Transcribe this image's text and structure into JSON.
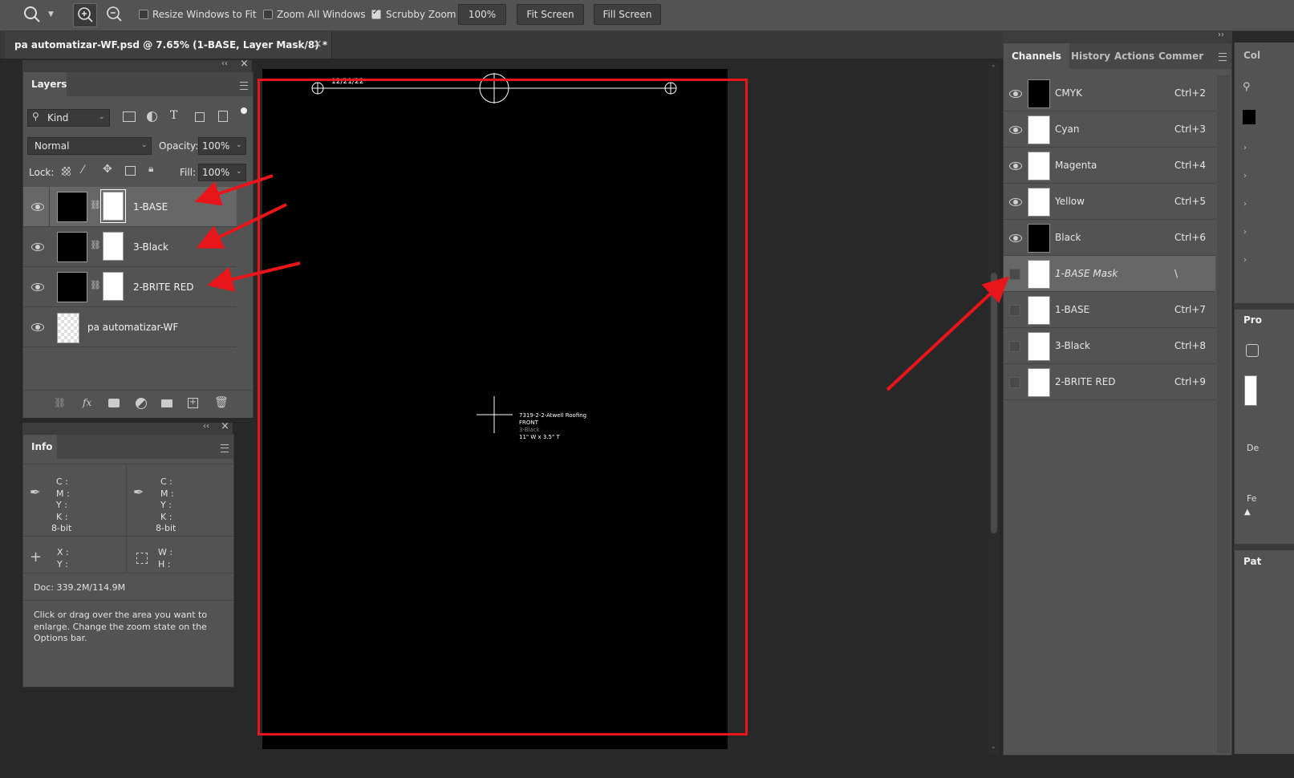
{
  "options_bar": {
    "resize_windows": "Resize Windows to Fit",
    "zoom_all": "Zoom All Windows",
    "scrubby_zoom": "Scrubby Zoom",
    "zoom_value": "100%",
    "fit_screen": "Fit Screen",
    "fill_screen": "Fill Screen"
  },
  "document_tab": {
    "title": "pa automatizar-WF.psd @ 7.65% (1-BASE, Layer Mask/8) *",
    "close": "×"
  },
  "layers_panel": {
    "tab": "Layers",
    "kind": "Kind",
    "blend_mode": "Normal",
    "opacity_label": "Opacity:",
    "opacity_value": "100%",
    "lock_label": "Lock:",
    "fill_label": "Fill:",
    "fill_value": "100%",
    "layers": [
      {
        "name": "1-BASE"
      },
      {
        "name": "3-Black"
      },
      {
        "name": "2-BRITE RED"
      },
      {
        "name": "pa automatizar-WF"
      }
    ],
    "fx_label": "fx"
  },
  "info_panel": {
    "tab": "Info",
    "cmyk_left": [
      "C :",
      "M :",
      "Y :",
      "K :"
    ],
    "cmyk_right": [
      "C :",
      "M :",
      "Y :",
      "K :"
    ],
    "bit_left": "8-bit",
    "bit_right": "8-bit",
    "xy": [
      "X :",
      "Y :"
    ],
    "wh": [
      "W :",
      "H :"
    ],
    "doc": "Doc: 339.2M/114.9M",
    "help_lines": [
      "Click or drag over the area you want to",
      "enlarge. Change the zoom state on the",
      "Options bar."
    ]
  },
  "canvas": {
    "date": "12/21/22",
    "info_lines": [
      "7319-2-2-Atwell Roofing",
      "FRONT",
      "3-Black",
      "11\" W x 3.5\" T"
    ]
  },
  "channels_panel": {
    "tabs": [
      "Channels",
      "History",
      "Actions",
      "Commer"
    ],
    "channels": [
      {
        "name": "CMYK",
        "shortcut": "Ctrl+2"
      },
      {
        "name": "Cyan",
        "shortcut": "Ctrl+3"
      },
      {
        "name": "Magenta",
        "shortcut": "Ctrl+4"
      },
      {
        "name": "Yellow",
        "shortcut": "Ctrl+5"
      },
      {
        "name": "Black",
        "shortcut": "Ctrl+6"
      },
      {
        "name": "1-BASE Mask",
        "shortcut": "\\"
      },
      {
        "name": "1-BASE",
        "shortcut": "Ctrl+7"
      },
      {
        "name": "3-Black",
        "shortcut": "Ctrl+8"
      },
      {
        "name": "2-BRITE RED",
        "shortcut": "Ctrl+9"
      }
    ]
  },
  "right_edge": {
    "col": "Col",
    "pro": "Pro",
    "de": "De",
    "fe": "Fe",
    "pat": "Pat"
  },
  "colors": {
    "annotation_red": "#e8161b",
    "panel": "#535353",
    "workspace": "#282828"
  }
}
